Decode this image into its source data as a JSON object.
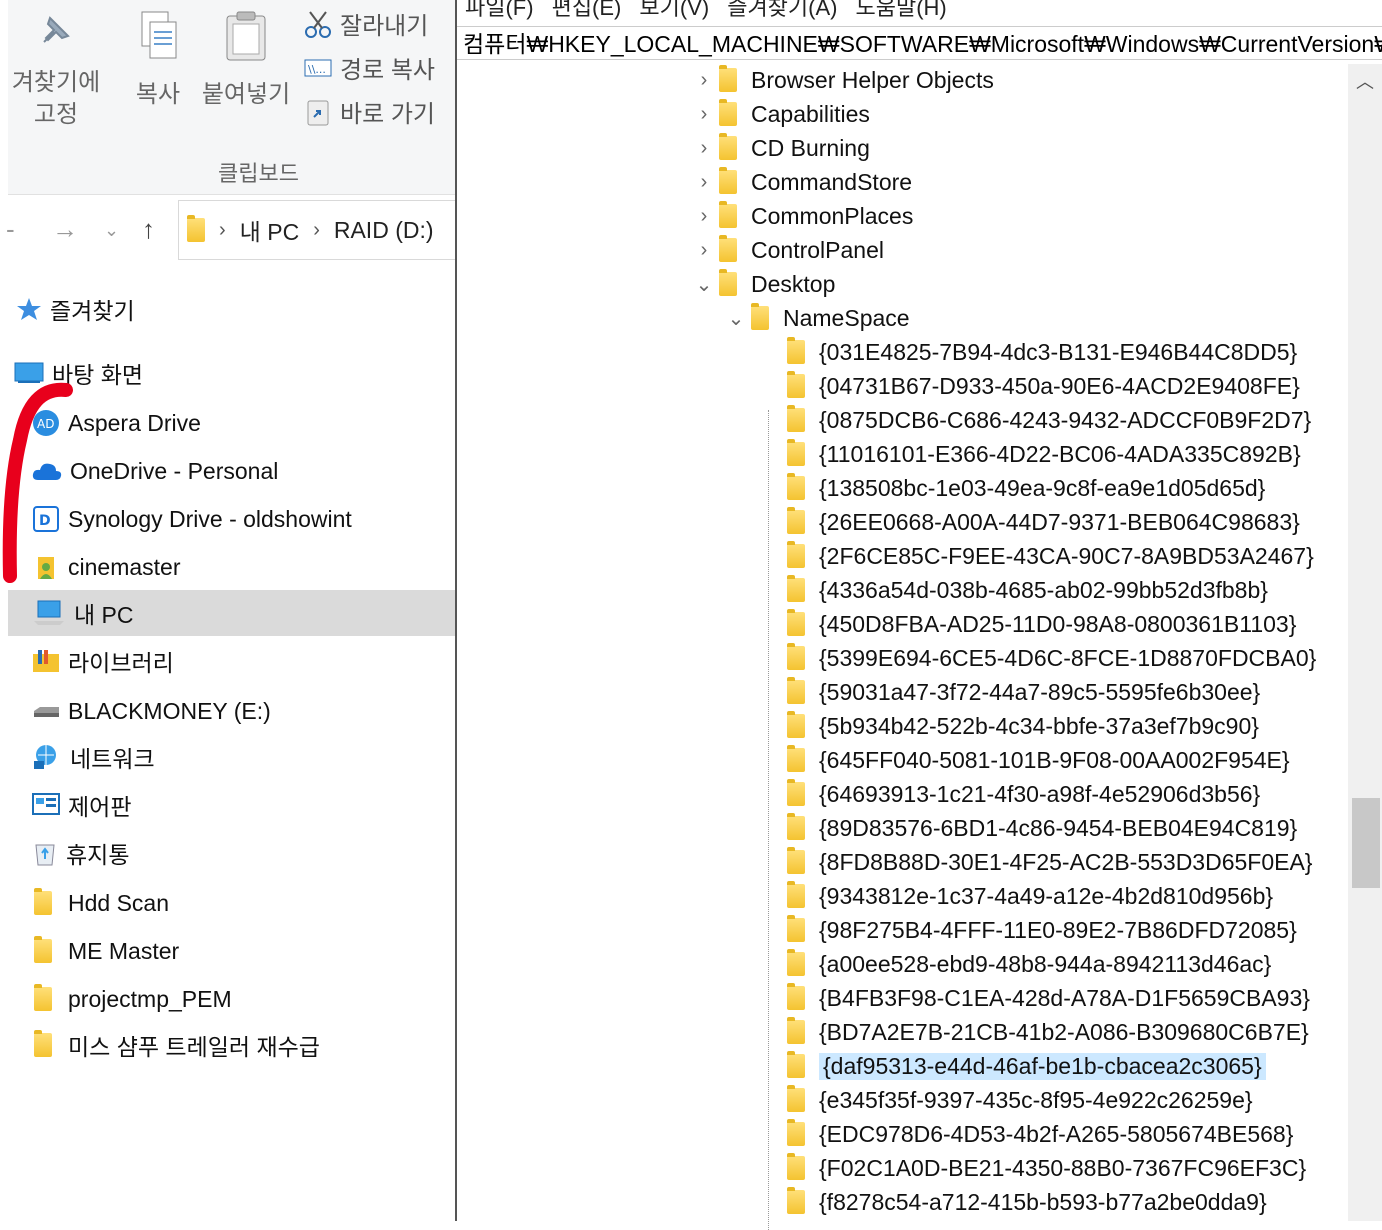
{
  "ribbon": {
    "pin_label": "겨찾기에\n고정",
    "copy_label": "복사",
    "paste_label": "붙여넣기",
    "cut_label": "잘라내기",
    "copy_path_label": "경로 복사",
    "shortcut_label": "바로 가기",
    "group_label": "클립보드"
  },
  "address": {
    "crumbs": [
      "내 PC",
      "RAID (D:)"
    ]
  },
  "nav": {
    "favorites": "즐겨찾기",
    "desktop": "바탕 화면",
    "aspera": "Aspera Drive",
    "onedrive": "OneDrive - Personal",
    "synology": "Synology Drive - oldshowint",
    "cinemaster": "cinemaster",
    "mypc": "내 PC",
    "library": "라이브러리",
    "blackmoney": "BLACKMONEY (E:)",
    "network": "네트워크",
    "control_panel": "제어판",
    "recycle": "휴지통",
    "hdd_scan": "Hdd Scan",
    "me_master": "ME Master",
    "projectmp": "projectmp_PEM",
    "miss_shampoo": "미스 샴푸 트레일러 재수급"
  },
  "regedit": {
    "menu": [
      "파일(F)",
      "편집(E)",
      "보기(V)",
      "즐겨찾기(A)",
      "도움말(H)"
    ],
    "path": "컴퓨터₩HKEY_LOCAL_MACHINE₩SOFTWARE₩Microsoft₩Windows₩CurrentVersion₩",
    "top_keys": [
      "Browser Helper Objects",
      "Capabilities",
      "CD Burning",
      "CommandStore",
      "CommonPlaces",
      "ControlPanel",
      "Desktop"
    ],
    "namespace": "NameSpace",
    "guids": [
      "{031E4825-7B94-4dc3-B131-E946B44C8DD5}",
      "{04731B67-D933-450a-90E6-4ACD2E9408FE}",
      "{0875DCB6-C686-4243-9432-ADCCF0B9F2D7}",
      "{11016101-E366-4D22-BC06-4ADA335C892B}",
      "{138508bc-1e03-49ea-9c8f-ea9e1d05d65d}",
      "{26EE0668-A00A-44D7-9371-BEB064C98683}",
      "{2F6CE85C-F9EE-43CA-90C7-8A9BD53A2467}",
      "{4336a54d-038b-4685-ab02-99bb52d3fb8b}",
      "{450D8FBA-AD25-11D0-98A8-0800361B1103}",
      "{5399E694-6CE5-4D6C-8FCE-1D8870FDCBA0}",
      "{59031a47-3f72-44a7-89c5-5595fe6b30ee}",
      "{5b934b42-522b-4c34-bbfe-37a3ef7b9c90}",
      "{645FF040-5081-101B-9F08-00AA002F954E}",
      "{64693913-1c21-4f30-a98f-4e52906d3b56}",
      "{89D83576-6BD1-4c86-9454-BEB04E94C819}",
      "{8FD8B88D-30E1-4F25-AC2B-553D3D65F0EA}",
      "{9343812e-1c37-4a49-a12e-4b2d810d956b}",
      "{98F275B4-4FFF-11E0-89E2-7B86DFD72085}",
      "{a00ee528-ebd9-48b8-944a-8942113d46ac}",
      "{B4FB3F98-C1EA-428d-A78A-D1F5659CBA93}",
      "{BD7A2E7B-21CB-41b2-A086-B309680C6B7E}",
      "{daf95313-e44d-46af-be1b-cbacea2c3065}",
      "{e345f35f-9397-435c-8f95-4e922c26259e}",
      "{EDC978D6-4D53-4b2f-A265-5805674BE568}",
      "{F02C1A0D-BE21-4350-88B0-7367FC96EF3C}",
      "{f8278c54-a712-415b-b593-b77a2be0dda9}"
    ],
    "selected_guid_index": 21
  },
  "colors": {
    "selection": "#cce8ff",
    "nav_selected": "#dadada",
    "marker": "#e8001c",
    "folder": "#f4c330"
  }
}
